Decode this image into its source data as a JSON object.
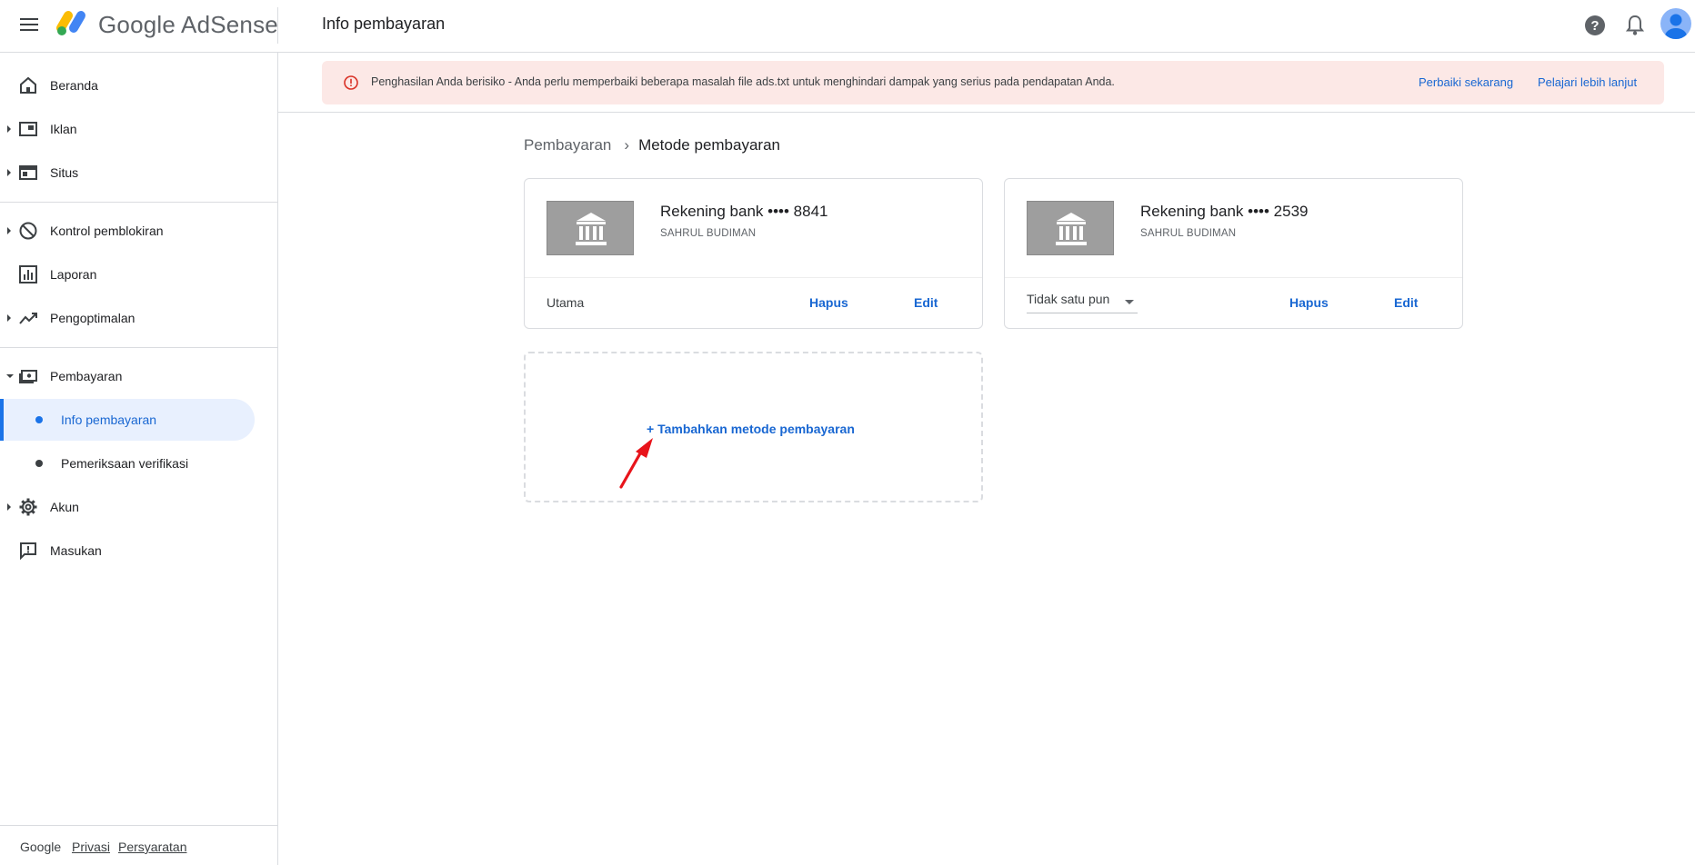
{
  "header": {
    "brand": "Google AdSense",
    "title": "Info pembayaran"
  },
  "alert": {
    "text": "Penghasilan Anda berisiko - Anda perlu memperbaiki beberapa masalah file ads.txt untuk menghindari dampak yang serius pada pendapatan Anda.",
    "fix_label": "Perbaiki sekarang",
    "learn_label": "Pelajari lebih lanjut"
  },
  "sidebar": {
    "items": [
      {
        "label": "Beranda",
        "icon": "home-icon"
      },
      {
        "label": "Iklan",
        "icon": "ads-icon"
      },
      {
        "label": "Situs",
        "icon": "sites-icon"
      },
      {
        "label": "Kontrol pemblokiran",
        "icon": "block-icon"
      },
      {
        "label": "Laporan",
        "icon": "reports-icon"
      },
      {
        "label": "Pengoptimalan",
        "icon": "trending-icon"
      },
      {
        "label": "Pembayaran",
        "icon": "payments-icon"
      },
      {
        "label": "Akun",
        "icon": "gear-icon"
      },
      {
        "label": "Masukan",
        "icon": "feedback-icon"
      }
    ],
    "sub_items": [
      {
        "label": "Info pembayaran",
        "active": true
      },
      {
        "label": "Pemeriksaan verifikasi",
        "active": false
      }
    ],
    "footer": {
      "google": "Google",
      "privacy": "Privasi",
      "terms": "Persyaratan"
    }
  },
  "breadcrumb": {
    "parent": "Pembayaran",
    "current": "Metode pembayaran"
  },
  "cards": [
    {
      "title": "Rekening bank •••• 8841",
      "name": "SAHRUL BUDIMAN",
      "status": "Utama",
      "delete_label": "Hapus",
      "edit_label": "Edit"
    },
    {
      "title": "Rekening bank •••• 2539",
      "name": "SAHRUL BUDIMAN",
      "select_value": "Tidak satu pun",
      "delete_label": "Hapus",
      "edit_label": "Edit"
    }
  ],
  "add_method": {
    "label": "+ Tambahkan metode pembayaran"
  },
  "colors": {
    "accent": "#1a73e8",
    "alert_bg": "#fce8e6",
    "annotation": "#e8141b"
  }
}
